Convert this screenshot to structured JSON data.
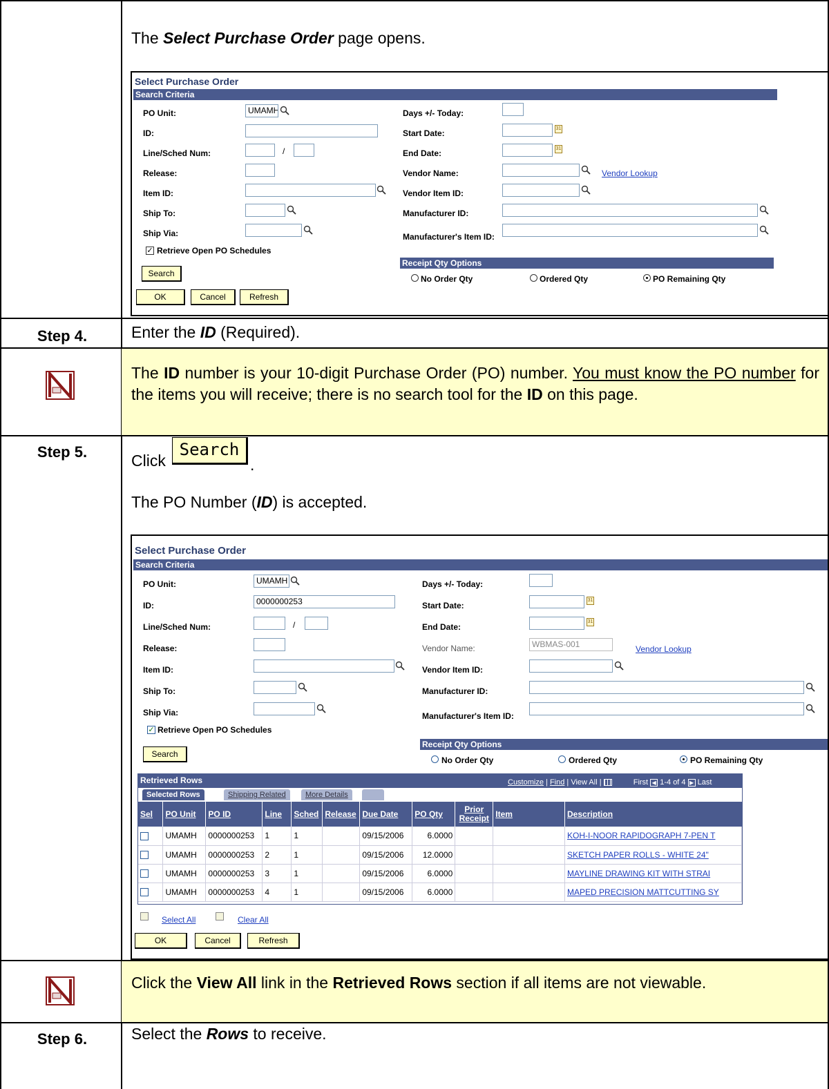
{
  "intro": {
    "prefix": "The ",
    "emph": "Select Purchase Order",
    "suffix": " page opens."
  },
  "shot1": {
    "title": "Select Purchase Order",
    "section": "Search Criteria",
    "labels": {
      "po_unit": "PO Unit:",
      "id": "ID:",
      "line_sched": "Line/Sched Num:",
      "release": "Release:",
      "item_id": "Item ID:",
      "ship_to": "Ship To:",
      "ship_via": "Ship Via:",
      "days": "Days +/- Today:",
      "start": "Start Date:",
      "end": "End Date:",
      "vendor_name": "Vendor Name:",
      "vendor_item": "Vendor Item ID:",
      "mfr_id": "Manufacturer ID:",
      "mfr_item": "Manufacturer's Item ID:"
    },
    "values": {
      "po_unit": "UMAMH",
      "id": "",
      "vendor_name": ""
    },
    "slash": "/",
    "vendor_lookup": "Vendor Lookup",
    "retrieve_open": "Retrieve Open PO Schedules",
    "search_btn": "Search",
    "receipt_qty": "Receipt Qty Options",
    "radios": [
      "No Order Qty",
      "Ordered Qty",
      "PO Remaining Qty"
    ],
    "selected_radio": "PO Remaining Qty",
    "buttons": {
      "ok": "OK",
      "cancel": "Cancel",
      "refresh": "Refresh"
    }
  },
  "step4": {
    "label": "Step 4.",
    "prefix": "Enter the ",
    "emph": "ID",
    "suffix": " (Required)."
  },
  "note1": {
    "t1": "The ",
    "b1": "ID",
    "t2": " number is your 10-digit Purchase Order (PO) number.  ",
    "u1": "You must know the PO number",
    "t3": " for the items you will receive; there is no search tool for the ",
    "b2": "ID",
    "t4": " on this page."
  },
  "step5": {
    "label": "Step 5.",
    "click": "Click ",
    "btn": "Search",
    "period": ".",
    "accepted_prefix": "The PO Number (",
    "accepted_emph": "ID",
    "accepted_suffix": ") is accepted."
  },
  "shot2": {
    "title": "Select Purchase Order",
    "section": "Search Criteria",
    "values": {
      "po_unit": "UMAMH",
      "id": "0000000253",
      "vendor_name": "WBMAS-001"
    },
    "grid": {
      "title": "Retrieved Rows",
      "nav": {
        "customize": "Customize",
        "find": "Find",
        "view_all": "View All",
        "first": "First",
        "range": "1-4 of 4",
        "last": "Last",
        "sep": "|"
      },
      "tabs": [
        "Selected Rows",
        "Shipping Related",
        "More Details"
      ],
      "columns": [
        "Sel",
        "PO Unit",
        "PO ID",
        "Line",
        "Sched",
        "Release",
        "Due Date",
        "PO Qty",
        "Prior Receipt",
        "Item",
        "Description"
      ],
      "rows": [
        {
          "po_unit": "UMAMH",
          "po_id": "0000000253",
          "line": "1",
          "sched": "1",
          "release": "",
          "due": "09/15/2006",
          "qty": "6.0000",
          "prior": "",
          "item": "",
          "desc": "KOH-I-NOOR RAPIDOGRAPH 7-PEN T"
        },
        {
          "po_unit": "UMAMH",
          "po_id": "0000000253",
          "line": "2",
          "sched": "1",
          "release": "",
          "due": "09/15/2006",
          "qty": "12.0000",
          "prior": "",
          "item": "",
          "desc": "SKETCH PAPER ROLLS - WHITE 24\""
        },
        {
          "po_unit": "UMAMH",
          "po_id": "0000000253",
          "line": "3",
          "sched": "1",
          "release": "",
          "due": "09/15/2006",
          "qty": "6.0000",
          "prior": "",
          "item": "",
          "desc": "MAYLINE DRAWING KIT WITH STRAI"
        },
        {
          "po_unit": "UMAMH",
          "po_id": "0000000253",
          "line": "4",
          "sched": "1",
          "release": "",
          "due": "09/15/2006",
          "qty": "6.0000",
          "prior": "",
          "item": "",
          "desc": "MAPED PRECISION MATTCUTTING SY"
        }
      ]
    },
    "select_all": "Select All",
    "clear_all": "Clear All"
  },
  "note2": {
    "t1": "Click the ",
    "b1": "View All",
    "t2": " link in the ",
    "b2": "Retrieved Rows",
    "t3": " section if all items are not viewable."
  },
  "step6": {
    "label": "Step 6.",
    "prefix": "Select the ",
    "emph": "Rows",
    "suffix": " to receive."
  },
  "colors": {
    "note_band": "#ffffcc",
    "header_bar": "#4a5a8e",
    "link": "#1f3fbf",
    "button": "#ffffcc"
  },
  "icons": [
    "note-icon",
    "magnifier-icon",
    "calendar-icon"
  ]
}
